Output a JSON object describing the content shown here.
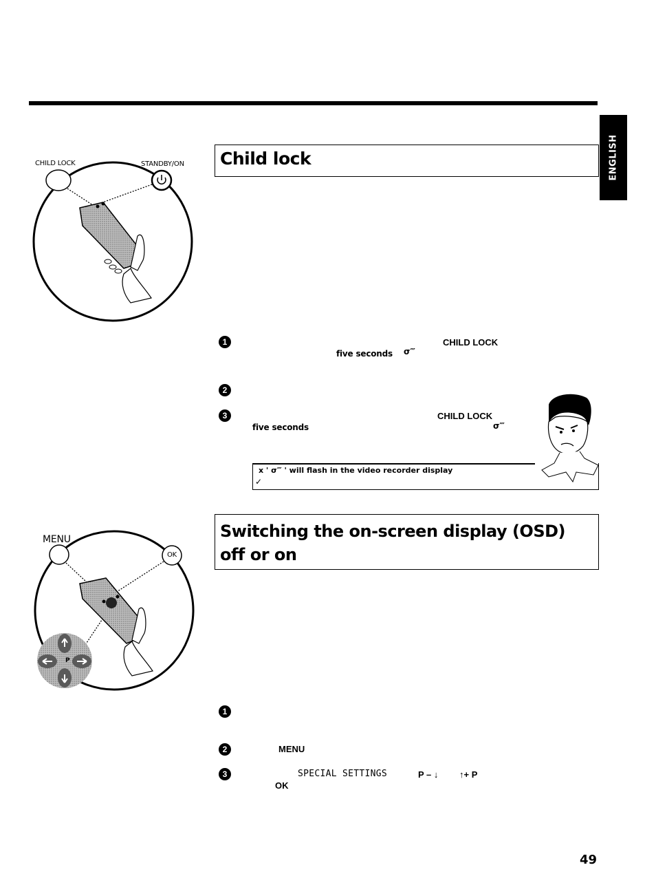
{
  "page": {
    "language_tab": "ENGLISH",
    "page_number": "49"
  },
  "child_lock": {
    "title": "Child lock",
    "illustration": {
      "label_left": "CHILD LOCK",
      "label_right": "STANDBY/ON",
      "right_button_icon": "power-icon"
    },
    "steps": [
      {
        "num": "1",
        "keyword": "CHILD LOCK",
        "detail": "five  seconds",
        "icon": "key-icon",
        "icon_glyph": "σ‴"
      },
      {
        "num": "2"
      },
      {
        "num": "3",
        "keyword": "CHILD LOCK",
        "detail": "five  seconds",
        "icon": "key-icon",
        "icon_glyph": "σ‴"
      }
    ],
    "note": {
      "text": "x ' σ‴ ' will flash in the video recorder display",
      "prefix": "x '",
      "glyph": "σ‴",
      "suffix": "' will flash in the video recorder display",
      "check": "✓"
    }
  },
  "osd": {
    "title": "Switching the on-screen display (OSD) off or on",
    "illustration": {
      "label_left": "MENU",
      "label_right": "OK",
      "dpad_center": "P"
    },
    "steps": [
      {
        "num": "1"
      },
      {
        "num": "2",
        "keyword": "MENU"
      },
      {
        "num": "3",
        "menu_item": "SPECIAL SETTINGS",
        "key_down": "P – ↓",
        "key_up": "↑+ P",
        "confirm": "OK"
      }
    ]
  }
}
